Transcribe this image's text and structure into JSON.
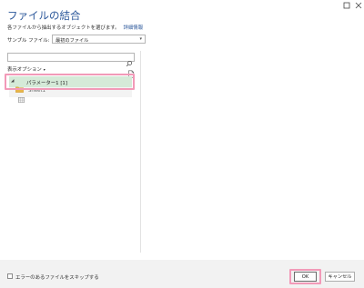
{
  "window": {
    "controls": [
      "maximize-icon",
      "close-icon"
    ]
  },
  "dialog": {
    "title": "ファイルの結合",
    "description": "各ファイルから抽出するオブジェクトを選びます。",
    "details_link": "詳細情報"
  },
  "sample_file": {
    "label": "サンプル ファイル:",
    "selected": "最初のファイル"
  },
  "navigator": {
    "search_value": "",
    "display_options": "表示オプション",
    "tree": [
      {
        "label": "パラメーター1 [1]",
        "icon": "folder-icon",
        "selected": true
      },
      {
        "label": "Sheet1",
        "icon": "table-icon",
        "selected": false
      }
    ]
  },
  "footer": {
    "skip_errors_label": "エラーのあるファイルをスキップする",
    "skip_errors_checked": false,
    "ok_label": "OK",
    "cancel_label": "キャンセル"
  },
  "colors": {
    "accent": "#2b579a",
    "selection": "#d5ead8",
    "highlight_annotation": "#f29ab8",
    "footer_bg": "#f2f2f2"
  }
}
